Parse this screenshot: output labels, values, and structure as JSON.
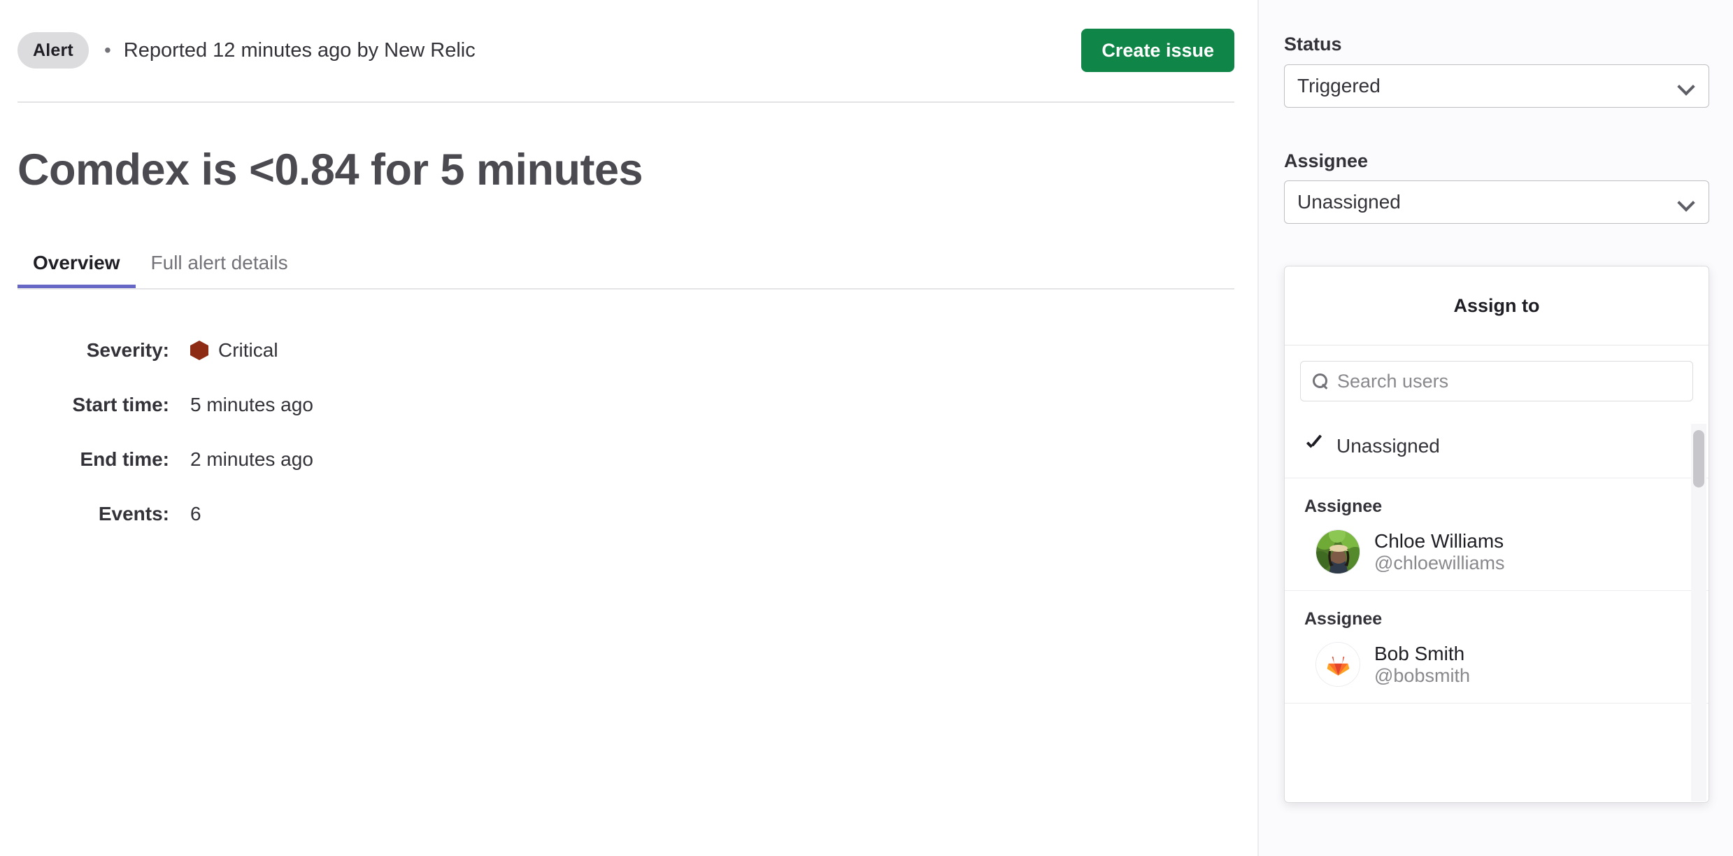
{
  "header": {
    "badge": "Alert",
    "separator": "•",
    "reported": "Reported 12 minutes ago by New Relic",
    "create_issue_label": "Create issue"
  },
  "title": "Comdex is <0.84 for 5 minutes",
  "tabs": [
    {
      "label": "Overview",
      "active": true
    },
    {
      "label": "Full alert details",
      "active": false
    }
  ],
  "details": [
    {
      "label": "Severity:",
      "value": "Critical",
      "icon": "severity-hexagon",
      "icon_color": "#8d2b15"
    },
    {
      "label": "Start time:",
      "value": "5 minutes ago"
    },
    {
      "label": "End time:",
      "value": "2 minutes ago"
    },
    {
      "label": "Events:",
      "value": "6"
    }
  ],
  "sidebar": {
    "status_label": "Status",
    "status_value": "Triggered",
    "assignee_label": "Assignee",
    "assignee_value": "Unassigned",
    "dropdown": {
      "header": "Assign to",
      "search_placeholder": "Search users",
      "search_value": "",
      "unassigned_option": "Unassigned",
      "groups": [
        {
          "title": "Assignee",
          "user": {
            "name": "Chloe Williams",
            "handle": "@chloewilliams",
            "avatar": "photo-avatar-chloe"
          }
        },
        {
          "title": "Assignee",
          "user": {
            "name": "Bob Smith",
            "handle": "@bobsmith",
            "avatar": "gitlab-tanuki-avatar"
          }
        }
      ]
    }
  },
  "colors": {
    "accent_green": "#108548",
    "tab_underline": "#6666c4",
    "severity_critical": "#8d2b15",
    "badge_bg": "#dcdcde"
  }
}
